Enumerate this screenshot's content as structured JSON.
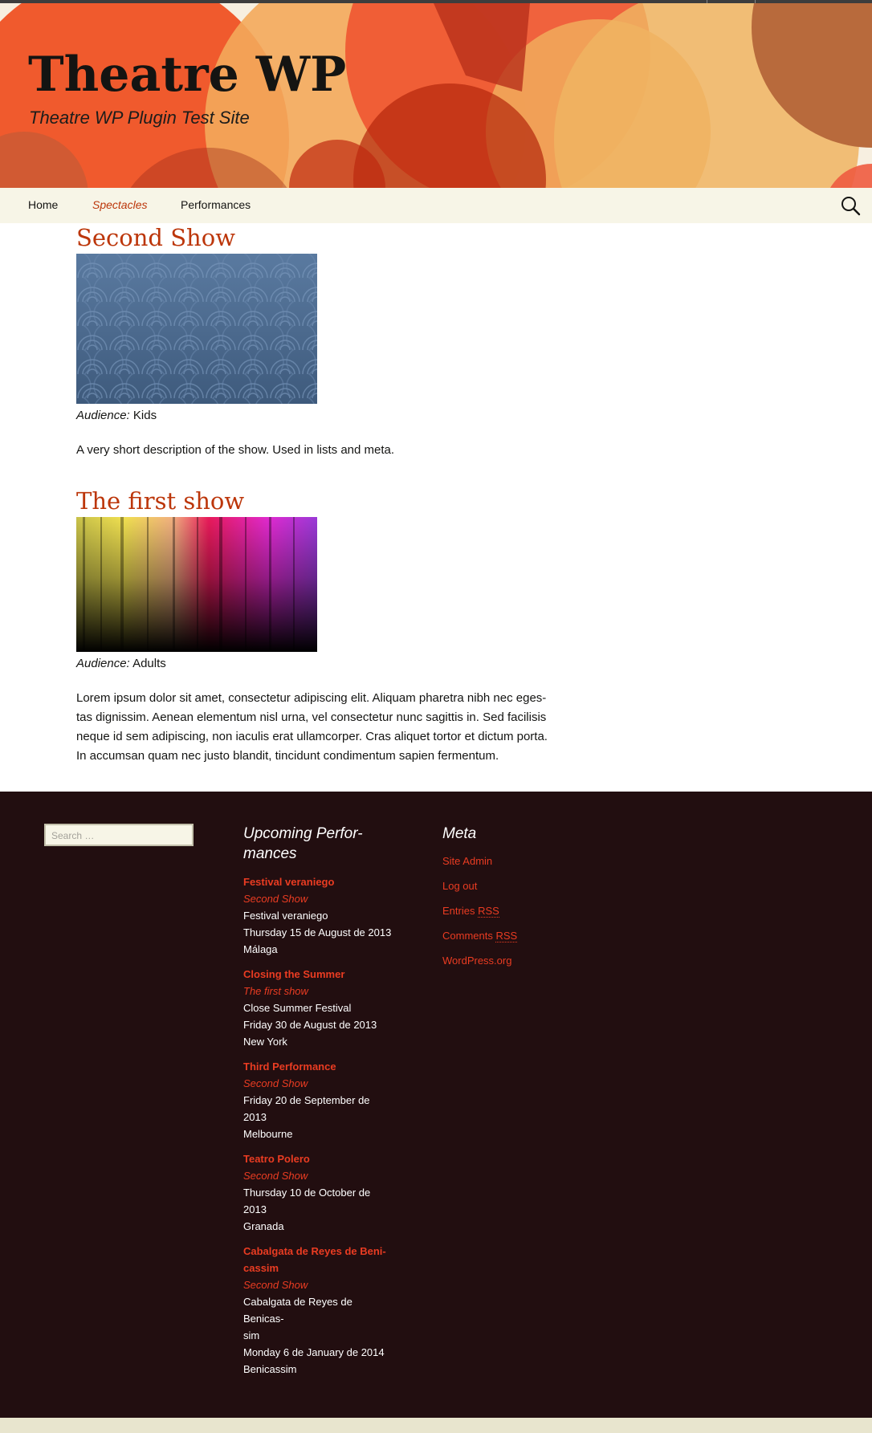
{
  "site": {
    "title": "Theatre WP",
    "description": "Theatre WP Plugin Test Site"
  },
  "nav": {
    "items": [
      {
        "label": "Home",
        "current": false
      },
      {
        "label": "Spectacles",
        "current": true
      },
      {
        "label": "Performances",
        "current": false
      }
    ],
    "search_icon": "search-icon"
  },
  "posts": [
    {
      "title": "Second Show",
      "image": "blue-circles-pattern",
      "audience_label": "Audience:",
      "audience_value": "Kids",
      "excerpt": "A very short description of the show. Used in lists and meta."
    },
    {
      "title": "The first show",
      "image": "colorful-light-streaks",
      "audience_label": "Audience:",
      "audience_value": "Adults",
      "excerpt_lines": [
        "Lorem ipsum dolor sit amet, consectetur adipiscing elit. Aliquam pharetra nibh nec eges-",
        "tas dignissim. Aenean elementum nisl urna, vel consectetur nunc sagittis in. Sed facilisis",
        "neque id sem adipiscing, non iaculis erat ullamcorper. Cras aliquet tortor et dictum porta.",
        "In accumsan quam nec justo blandit, tincidunt condimentum sapien fermentum."
      ]
    }
  ],
  "footer": {
    "search_placeholder": "Search …",
    "performances_title_lines": [
      "Upcoming Perfor-",
      "mances"
    ],
    "performances": [
      {
        "title_lines": [
          "Festival veraniego"
        ],
        "show": "Second Show",
        "lines": [
          "Festival veraniego",
          "Thursday 15 de August de 2013",
          "Málaga"
        ]
      },
      {
        "title_lines": [
          "Closing the Summer"
        ],
        "show": "The first show",
        "lines": [
          "Close Summer Festival",
          "Friday 30 de August de 2013",
          "New York"
        ]
      },
      {
        "title_lines": [
          "Third Performance"
        ],
        "show": "Second Show",
        "lines": [
          "Friday 20 de September de",
          "2013",
          "Melbourne"
        ]
      },
      {
        "title_lines": [
          "Teatro Polero"
        ],
        "show": "Second Show",
        "lines": [
          "Thursday 10 de October de",
          "2013",
          "Granada"
        ]
      },
      {
        "title_lines": [
          "Cabalgata de Reyes de Beni-",
          "cassim"
        ],
        "show": "Second Show",
        "lines": [
          "Cabalgata de Reyes de Benicas-",
          "sim",
          "Monday 6 de January de 2014",
          "Benicassim"
        ]
      }
    ],
    "meta_title": "Meta",
    "meta_links": [
      {
        "text": "Site Admin",
        "abbr": ""
      },
      {
        "text": "Log out",
        "abbr": ""
      },
      {
        "text": "Entries ",
        "abbr": "RSS"
      },
      {
        "text": "Comments ",
        "abbr": "RSS"
      },
      {
        "text": "WordPress.org",
        "abbr": ""
      }
    ]
  },
  "colors": {
    "accent": "#bc360a",
    "footer_bg": "#220e10",
    "footer_link": "#ea3c22",
    "nav_bg": "#f7f5e7"
  }
}
